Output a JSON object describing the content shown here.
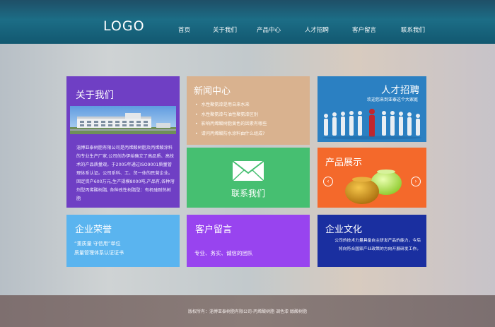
{
  "header": {
    "logo": "LOGO",
    "nav": [
      {
        "label": "首页"
      },
      {
        "label": "关于我们"
      },
      {
        "label": "产品中心"
      },
      {
        "label": "人才招聘"
      },
      {
        "label": "客户留言"
      },
      {
        "label": "联系我们"
      }
    ]
  },
  "about": {
    "title": "关于我们",
    "text": "淄博亚泰树脂有限公司是丙烯酸树脂及丙烯酸涂料的专业生产厂家,公司创办伊始确立了高品质、高技术的产品质量观，于2005年通过ISO9001质量管理体系认证。公司系科、工、贸一体的民营企业。固定资产600万元,生产规模8000吨,产品有,各种溶剂型丙烯酸树脂, 各种改性树脂型：有机硅耐热树脂"
  },
  "news": {
    "title": "新闻中心",
    "items": [
      "水性聚氨漆是用自来水来",
      "水性聚氨漆与油性聚氨漆区别",
      "影响丙烯酸树脂黄色的因素有哪些",
      "请问丙烯酸防水涂料由什么组成?"
    ]
  },
  "jobs": {
    "title": "人才招聘",
    "subtitle": "欢迎您来到亚泰这个大家庭"
  },
  "contact": {
    "label": "联系我们"
  },
  "products": {
    "title": "产品展示",
    "prev": "‹",
    "next": "›"
  },
  "honor": {
    "title": "企业荣誉",
    "line1": "“重质量 守信用”单位",
    "line2": "质量管理体系认证证书"
  },
  "message": {
    "title": "客户留言",
    "text": "专业、务实、诚信的团队"
  },
  "culture": {
    "title": "企业文化",
    "text": "公司的技术力量具备自主研发产品的能力，今后将向符合国家产业政策的方向开展研发工作。"
  },
  "footer": {
    "text": "版权所有：淄博亚泰树脂有限公司-丙烯酸树脂 调色漆 醇酸树脂"
  },
  "colors": {
    "header": "#1c6d86",
    "about": "#6f3fc4",
    "news": "#d9b28f",
    "jobs": "#2b80c2",
    "contact": "#46bf71",
    "products": "#f4692b",
    "honor": "#5ab4ef",
    "message": "#9844ef",
    "culture": "#1a2fa0"
  }
}
